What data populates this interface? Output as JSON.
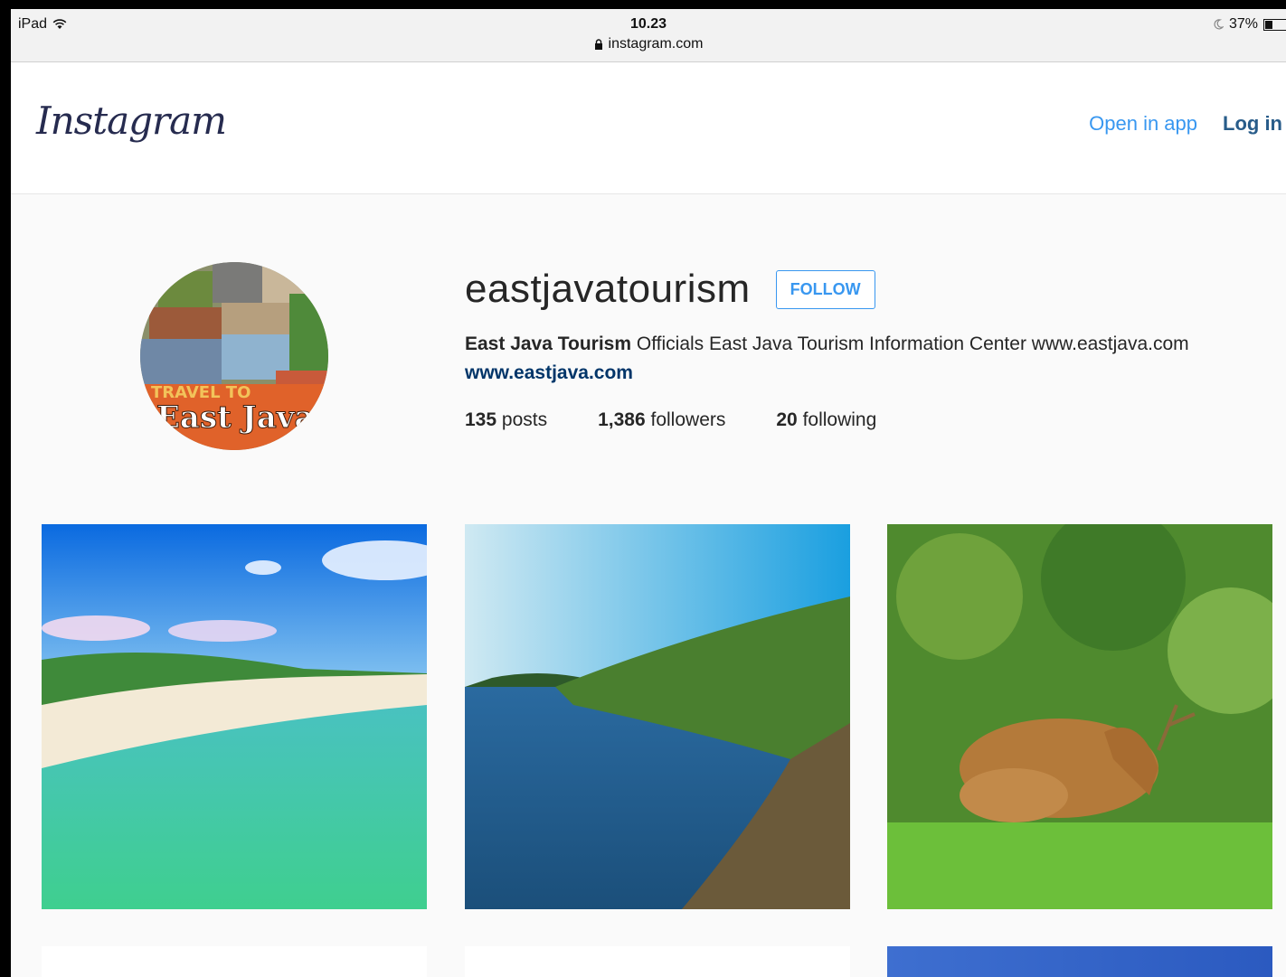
{
  "status_bar": {
    "device": "iPad",
    "time": "10.23",
    "url": "instagram.com",
    "battery": "37%",
    "battery_level": 0.37
  },
  "header": {
    "logo_text": "Instagram",
    "open_in_app": "Open in app",
    "log_in": "Log in"
  },
  "profile": {
    "avatar_text": "East Java",
    "avatar_subtext": "TRAVEL TO",
    "username": "eastjavatourism",
    "follow_label": "FOLLOW",
    "full_name": "East Java Tourism",
    "bio": "Officials East Java Tourism Information Center www.eastjava.com",
    "website": "www.eastjava.com",
    "stats": {
      "posts_count": "135",
      "posts_label": "posts",
      "followers_count": "1,386",
      "followers_label": "followers",
      "following_count": "20",
      "following_label": "following"
    }
  },
  "colors": {
    "accent": "#3897f0",
    "link": "#003569",
    "text": "#262626"
  },
  "posts": [
    {
      "subject": "beach-photo"
    },
    {
      "subject": "coastal-cliff-photo"
    },
    {
      "subject": "deer-photo"
    }
  ]
}
